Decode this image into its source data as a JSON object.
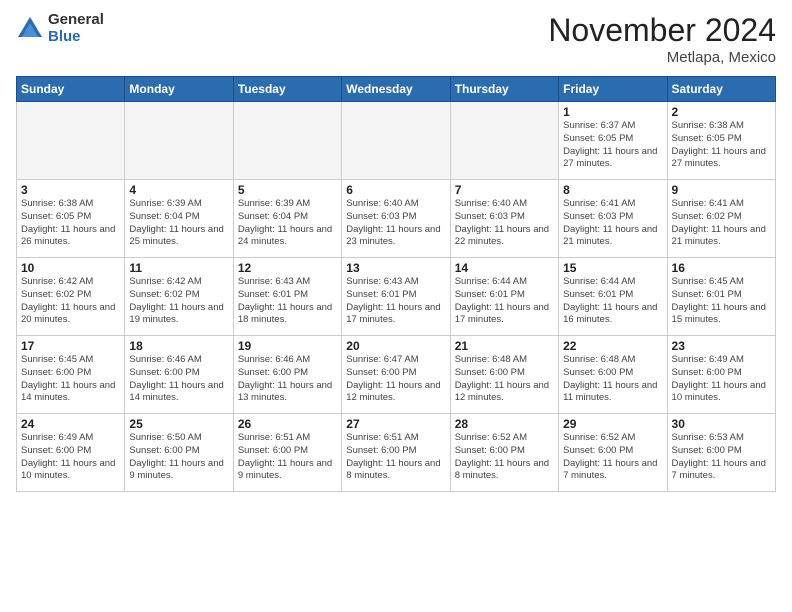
{
  "logo": {
    "general": "General",
    "blue": "Blue"
  },
  "title": "November 2024",
  "location": "Metlapa, Mexico",
  "days_header": [
    "Sunday",
    "Monday",
    "Tuesday",
    "Wednesday",
    "Thursday",
    "Friday",
    "Saturday"
  ],
  "weeks": [
    [
      {
        "day": "",
        "info": ""
      },
      {
        "day": "",
        "info": ""
      },
      {
        "day": "",
        "info": ""
      },
      {
        "day": "",
        "info": ""
      },
      {
        "day": "",
        "info": ""
      },
      {
        "day": "1",
        "info": "Sunrise: 6:37 AM\nSunset: 6:05 PM\nDaylight: 11 hours and 27 minutes."
      },
      {
        "day": "2",
        "info": "Sunrise: 6:38 AM\nSunset: 6:05 PM\nDaylight: 11 hours and 27 minutes."
      }
    ],
    [
      {
        "day": "3",
        "info": "Sunrise: 6:38 AM\nSunset: 6:05 PM\nDaylight: 11 hours and 26 minutes."
      },
      {
        "day": "4",
        "info": "Sunrise: 6:39 AM\nSunset: 6:04 PM\nDaylight: 11 hours and 25 minutes."
      },
      {
        "day": "5",
        "info": "Sunrise: 6:39 AM\nSunset: 6:04 PM\nDaylight: 11 hours and 24 minutes."
      },
      {
        "day": "6",
        "info": "Sunrise: 6:40 AM\nSunset: 6:03 PM\nDaylight: 11 hours and 23 minutes."
      },
      {
        "day": "7",
        "info": "Sunrise: 6:40 AM\nSunset: 6:03 PM\nDaylight: 11 hours and 22 minutes."
      },
      {
        "day": "8",
        "info": "Sunrise: 6:41 AM\nSunset: 6:03 PM\nDaylight: 11 hours and 21 minutes."
      },
      {
        "day": "9",
        "info": "Sunrise: 6:41 AM\nSunset: 6:02 PM\nDaylight: 11 hours and 21 minutes."
      }
    ],
    [
      {
        "day": "10",
        "info": "Sunrise: 6:42 AM\nSunset: 6:02 PM\nDaylight: 11 hours and 20 minutes."
      },
      {
        "day": "11",
        "info": "Sunrise: 6:42 AM\nSunset: 6:02 PM\nDaylight: 11 hours and 19 minutes."
      },
      {
        "day": "12",
        "info": "Sunrise: 6:43 AM\nSunset: 6:01 PM\nDaylight: 11 hours and 18 minutes."
      },
      {
        "day": "13",
        "info": "Sunrise: 6:43 AM\nSunset: 6:01 PM\nDaylight: 11 hours and 17 minutes."
      },
      {
        "day": "14",
        "info": "Sunrise: 6:44 AM\nSunset: 6:01 PM\nDaylight: 11 hours and 17 minutes."
      },
      {
        "day": "15",
        "info": "Sunrise: 6:44 AM\nSunset: 6:01 PM\nDaylight: 11 hours and 16 minutes."
      },
      {
        "day": "16",
        "info": "Sunrise: 6:45 AM\nSunset: 6:01 PM\nDaylight: 11 hours and 15 minutes."
      }
    ],
    [
      {
        "day": "17",
        "info": "Sunrise: 6:45 AM\nSunset: 6:00 PM\nDaylight: 11 hours and 14 minutes."
      },
      {
        "day": "18",
        "info": "Sunrise: 6:46 AM\nSunset: 6:00 PM\nDaylight: 11 hours and 14 minutes."
      },
      {
        "day": "19",
        "info": "Sunrise: 6:46 AM\nSunset: 6:00 PM\nDaylight: 11 hours and 13 minutes."
      },
      {
        "day": "20",
        "info": "Sunrise: 6:47 AM\nSunset: 6:00 PM\nDaylight: 11 hours and 12 minutes."
      },
      {
        "day": "21",
        "info": "Sunrise: 6:48 AM\nSunset: 6:00 PM\nDaylight: 11 hours and 12 minutes."
      },
      {
        "day": "22",
        "info": "Sunrise: 6:48 AM\nSunset: 6:00 PM\nDaylight: 11 hours and 11 minutes."
      },
      {
        "day": "23",
        "info": "Sunrise: 6:49 AM\nSunset: 6:00 PM\nDaylight: 11 hours and 10 minutes."
      }
    ],
    [
      {
        "day": "24",
        "info": "Sunrise: 6:49 AM\nSunset: 6:00 PM\nDaylight: 11 hours and 10 minutes."
      },
      {
        "day": "25",
        "info": "Sunrise: 6:50 AM\nSunset: 6:00 PM\nDaylight: 11 hours and 9 minutes."
      },
      {
        "day": "26",
        "info": "Sunrise: 6:51 AM\nSunset: 6:00 PM\nDaylight: 11 hours and 9 minutes."
      },
      {
        "day": "27",
        "info": "Sunrise: 6:51 AM\nSunset: 6:00 PM\nDaylight: 11 hours and 8 minutes."
      },
      {
        "day": "28",
        "info": "Sunrise: 6:52 AM\nSunset: 6:00 PM\nDaylight: 11 hours and 8 minutes."
      },
      {
        "day": "29",
        "info": "Sunrise: 6:52 AM\nSunset: 6:00 PM\nDaylight: 11 hours and 7 minutes."
      },
      {
        "day": "30",
        "info": "Sunrise: 6:53 AM\nSunset: 6:00 PM\nDaylight: 11 hours and 7 minutes."
      }
    ]
  ]
}
